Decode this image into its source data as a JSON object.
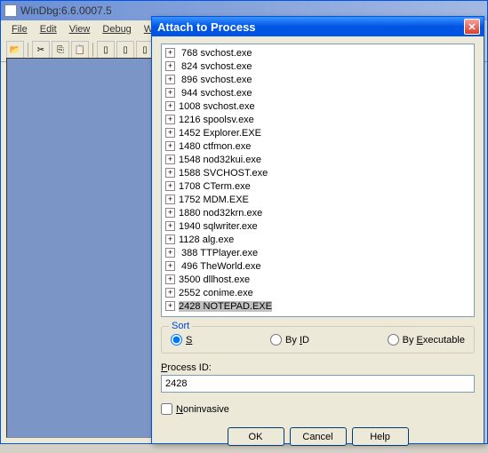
{
  "main": {
    "title": "WinDbg:6.6.0007.5",
    "menus": [
      "File",
      "Edit",
      "View",
      "Debug",
      "Win"
    ]
  },
  "dialog": {
    "title": "Attach to Process",
    "close_label": "✕",
    "processes": [
      {
        "pid": "768",
        "name": "svchost.exe"
      },
      {
        "pid": "824",
        "name": "svchost.exe"
      },
      {
        "pid": "896",
        "name": "svchost.exe"
      },
      {
        "pid": "944",
        "name": "svchost.exe"
      },
      {
        "pid": "1008",
        "name": "svchost.exe"
      },
      {
        "pid": "1216",
        "name": "spoolsv.exe"
      },
      {
        "pid": "1452",
        "name": "Explorer.EXE"
      },
      {
        "pid": "1480",
        "name": "ctfmon.exe"
      },
      {
        "pid": "1548",
        "name": "nod32kui.exe"
      },
      {
        "pid": "1588",
        "name": "SVCHOST.exe"
      },
      {
        "pid": "1708",
        "name": "CTerm.exe"
      },
      {
        "pid": "1752",
        "name": "MDM.EXE"
      },
      {
        "pid": "1880",
        "name": "nod32krn.exe"
      },
      {
        "pid": "1940",
        "name": "sqlwriter.exe"
      },
      {
        "pid": "1128",
        "name": "alg.exe"
      },
      {
        "pid": "388",
        "name": "TTPlayer.exe"
      },
      {
        "pid": "496",
        "name": "TheWorld.exe"
      },
      {
        "pid": "3500",
        "name": "dllhost.exe"
      },
      {
        "pid": "2552",
        "name": "conime.exe"
      },
      {
        "pid": "2428",
        "name": "NOTEPAD.EXE",
        "selected": true
      }
    ],
    "sort": {
      "legend": "Sort",
      "system_order": "System order",
      "by_id": "By ID",
      "by_executable": "By Executable",
      "selected": "system_order"
    },
    "pid_label": "Process ID:",
    "pid_value": "2428",
    "noninvasive_label": "Noninvasive",
    "buttons": {
      "ok": "OK",
      "cancel": "Cancel",
      "help": "Help"
    }
  }
}
